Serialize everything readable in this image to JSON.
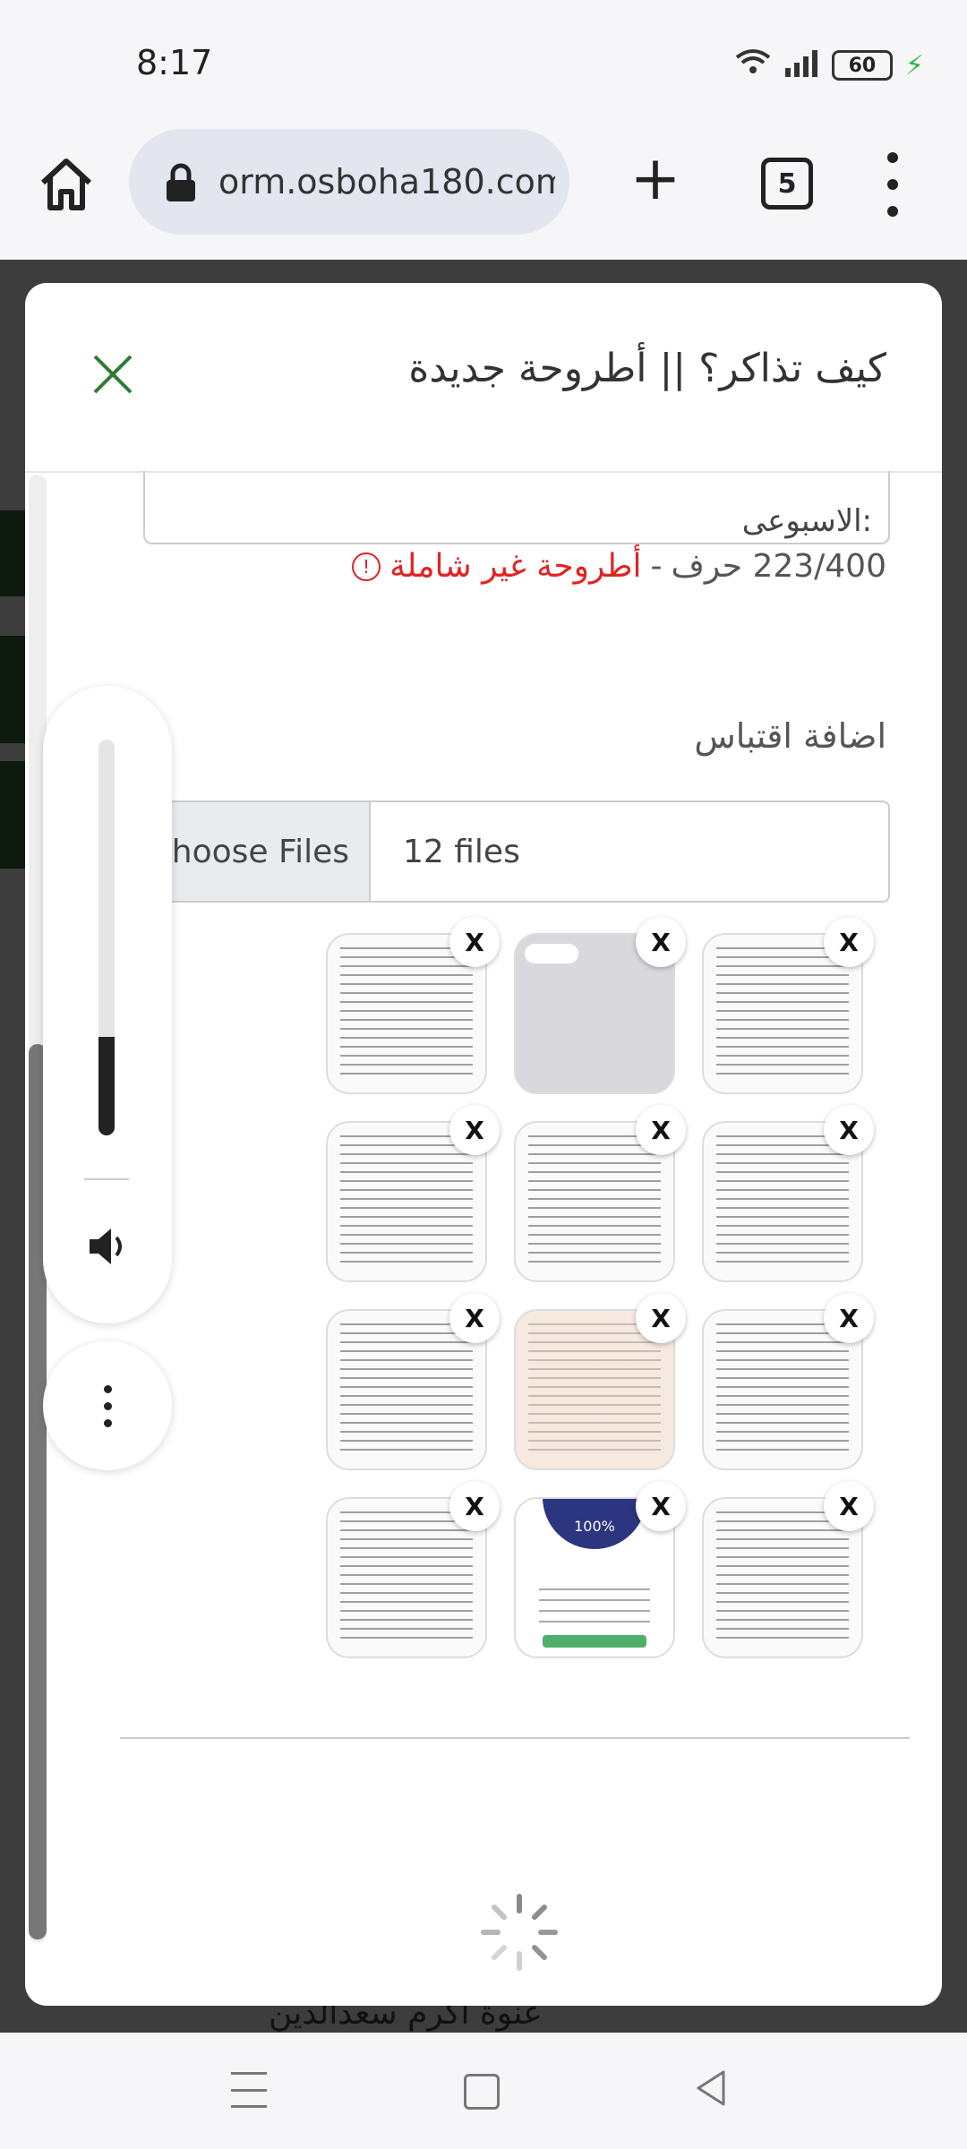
{
  "status_bar": {
    "time": "8:17",
    "battery": "60"
  },
  "browser": {
    "url": "orm.osboha180.com",
    "tab_count": "5"
  },
  "modal": {
    "title": "كيف تذاكر؟ || أطروحة جديدة",
    "textarea_visible_text": ":الاسبوعى",
    "counter": "223/400 حرف",
    "counter_separator": "-",
    "warning": "أطروحة غير شاملة",
    "section_label": "اضافة اقتباس",
    "file_button": "Choose Files",
    "file_count": "12 files",
    "remove_label": "X",
    "gauge_percent": "100%"
  },
  "background_page": {
    "partial_text": "عنوة أكرم سعدالدين"
  },
  "volume_level": 0.25
}
